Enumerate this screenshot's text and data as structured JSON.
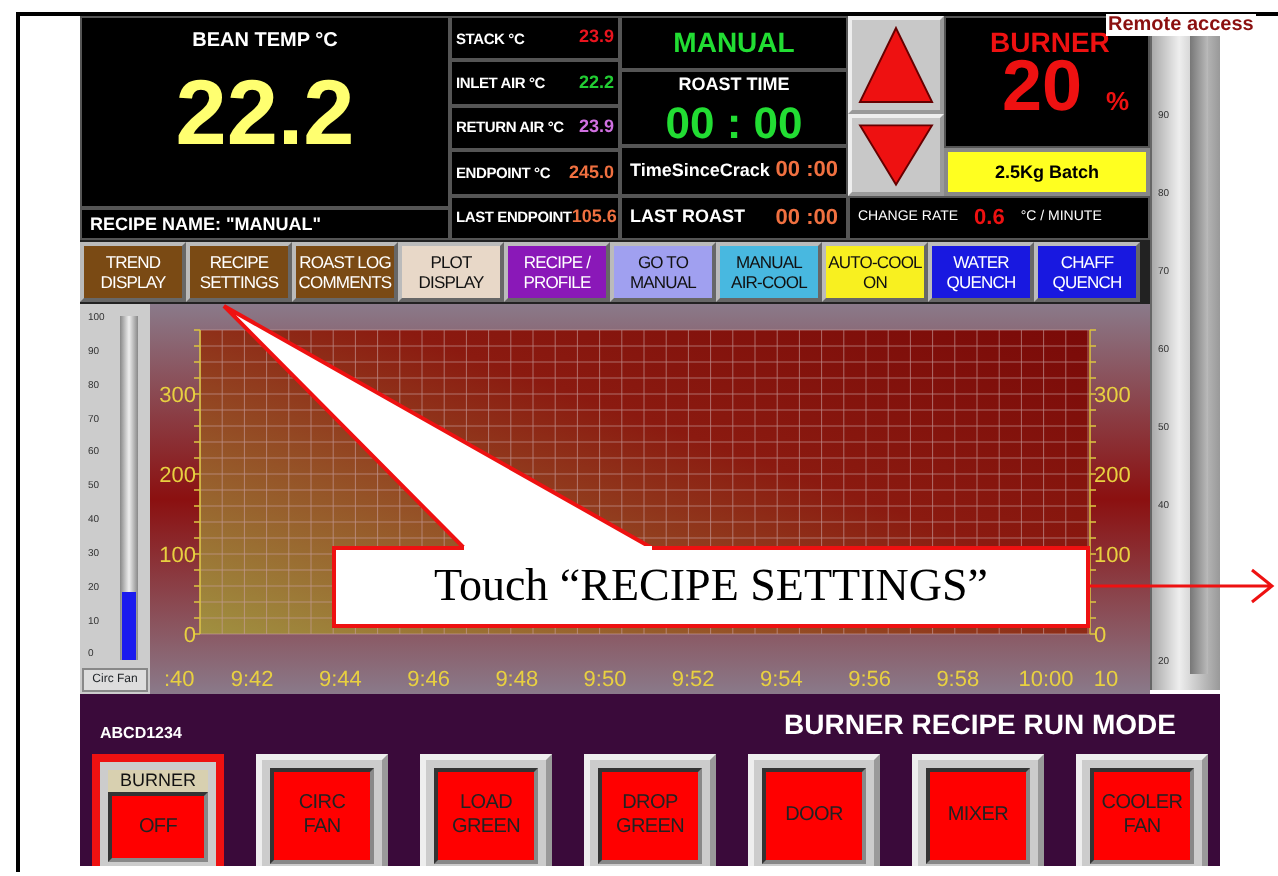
{
  "bean_temp": {
    "label": "BEAN TEMP °C",
    "value": "22.2"
  },
  "recipe_name": "RECIPE NAME: \"MANUAL\"",
  "readings": [
    {
      "label": "STACK °C",
      "value": "23.9",
      "color": "#e8141e"
    },
    {
      "label": "INLET AIR °C",
      "value": "22.2",
      "color": "#22cc33"
    },
    {
      "label": "RETURN AIR °C",
      "value": "23.9",
      "color": "#d070e0"
    },
    {
      "label": "ENDPOINT °C",
      "value": "245.0",
      "color": "#f07040"
    },
    {
      "label": "LAST ENDPOINT",
      "value": "105.6",
      "color": "#f07040"
    }
  ],
  "mode": "MANUAL",
  "roast_time": {
    "label": "ROAST TIME",
    "value": "00 : 00"
  },
  "time_since_crack": {
    "label": "TimeSinceCrack",
    "value": "00 :00"
  },
  "last_roast": {
    "label": "LAST ROAST",
    "value": "00 :00"
  },
  "burner": {
    "label": "BURNER",
    "value": "20",
    "unit": "%"
  },
  "batch": "2.5Kg Batch",
  "change_rate": {
    "label": "CHANGE RATE",
    "value": "0.6",
    "unit": "°C / MINUTE"
  },
  "remote_access": "Remote access",
  "nav_buttons": [
    {
      "label": "TREND\nDISPLAY",
      "color": "#7a4a14"
    },
    {
      "label": "RECIPE\nSETTINGS",
      "color": "#7a4a14"
    },
    {
      "label": "ROAST LOG\nCOMMENTS",
      "color": "#7a4a14"
    },
    {
      "label": "PLOT\nDISPLAY",
      "color": "#e8d8c8"
    },
    {
      "label": "RECIPE /\nPROFILE",
      "color": "#8a18b8"
    },
    {
      "label": "GO TO\nMANUAL",
      "color": "#a0a0f0"
    },
    {
      "label": "MANUAL\nAIR-COOL",
      "color": "#48b8e0"
    },
    {
      "label": "AUTO-COOL\nON",
      "color": "#f8f020"
    },
    {
      "label": "WATER\nQUENCH",
      "color": "#1818e0"
    },
    {
      "label": "CHAFF\nQUENCH",
      "color": "#1818e0"
    }
  ],
  "circ_fan_gauge": {
    "scale": [
      "100",
      "90",
      "80",
      "70",
      "60",
      "50",
      "40",
      "30",
      "20",
      "10",
      "0"
    ],
    "level": 0.2,
    "label": "Circ Fan"
  },
  "right_gauge": {
    "scale": [
      "90",
      "80",
      "70",
      "60",
      "50",
      "40",
      "20"
    ]
  },
  "chart": {
    "chart_data": {
      "type": "line",
      "categories": [
        ":40",
        "9:42",
        "9:44",
        "9:46",
        "9:48",
        "9:50",
        "9:52",
        "9:54",
        "9:56",
        "9:58",
        "10:00",
        "10"
      ],
      "ylim": [
        0,
        380
      ],
      "yticks": [
        0,
        100,
        200,
        300
      ],
      "grid": true
    },
    "right_axis_labels": [
      "300",
      "200",
      "100",
      "0"
    ]
  },
  "machine_id": "ABCD1234",
  "run_mode": "BURNER RECIPE RUN MODE",
  "control_buttons": [
    {
      "caption": "BURNER",
      "label": "OFF",
      "selected": true
    },
    {
      "label": "CIRC\nFAN",
      "selected": false
    },
    {
      "label": "LOAD\nGREEN",
      "selected": false
    },
    {
      "label": "DROP\nGREEN",
      "selected": false
    },
    {
      "label": "DOOR",
      "selected": false
    },
    {
      "label": "MIXER",
      "selected": false
    },
    {
      "label": "COOLER\nFAN",
      "selected": false
    }
  ],
  "callout": "Touch “RECIPE SETTINGS”"
}
